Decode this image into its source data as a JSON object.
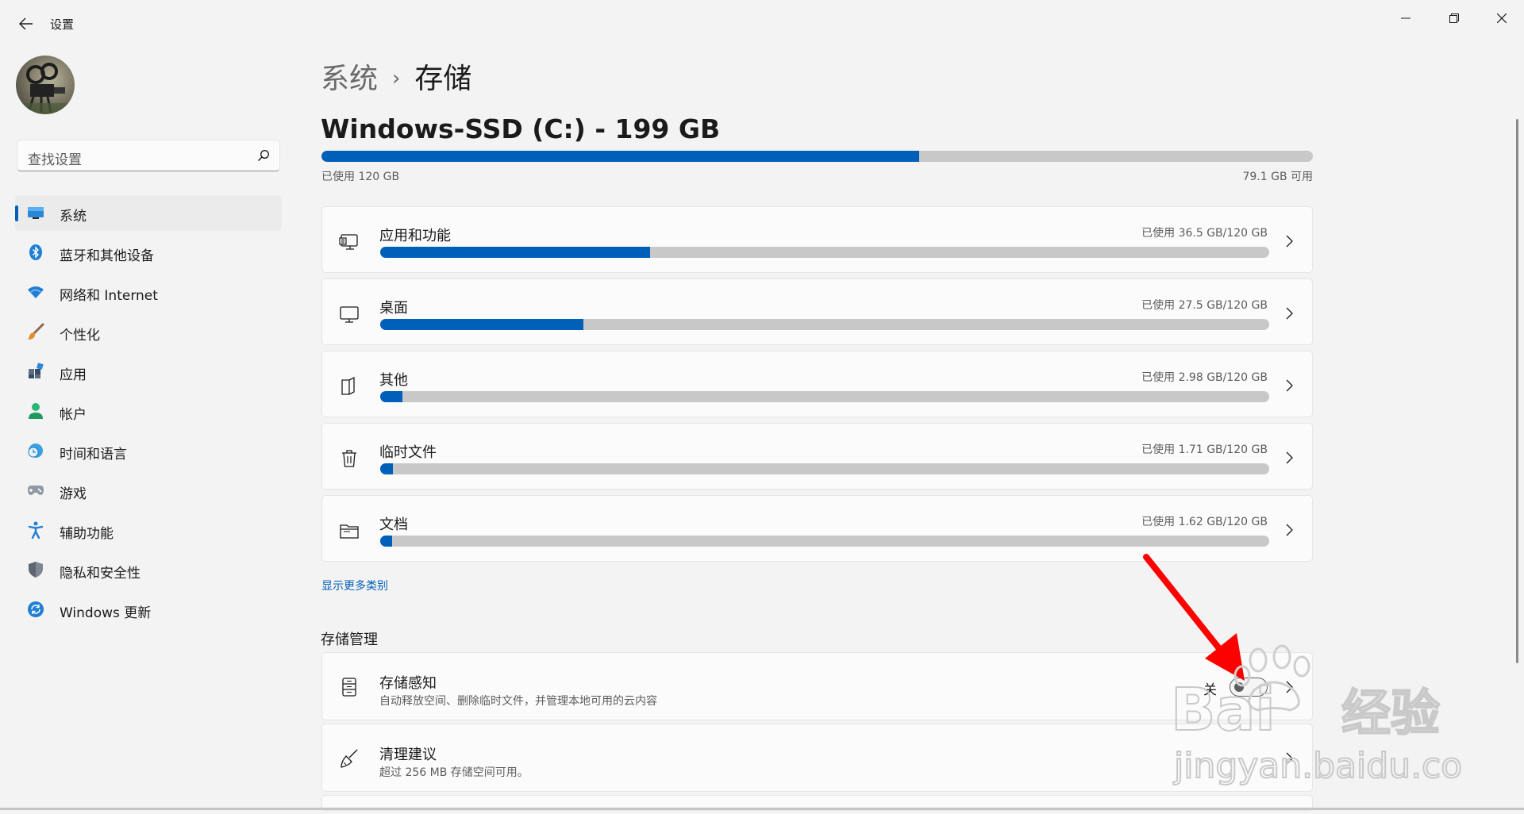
{
  "window": {
    "app_title": "设置"
  },
  "search": {
    "placeholder": "查找设置"
  },
  "sidebar": {
    "items": [
      {
        "label": "系统",
        "icon": "monitor-icon",
        "active": true
      },
      {
        "label": "蓝牙和其他设备",
        "icon": "bluetooth-icon",
        "active": false
      },
      {
        "label": "网络和 Internet",
        "icon": "wifi-icon",
        "active": false
      },
      {
        "label": "个性化",
        "icon": "brush-icon",
        "active": false
      },
      {
        "label": "应用",
        "icon": "apps-icon",
        "active": false
      },
      {
        "label": "帐户",
        "icon": "person-icon",
        "active": false
      },
      {
        "label": "时间和语言",
        "icon": "clock-globe-icon",
        "active": false
      },
      {
        "label": "游戏",
        "icon": "gamepad-icon",
        "active": false
      },
      {
        "label": "辅助功能",
        "icon": "accessibility-icon",
        "active": false
      },
      {
        "label": "隐私和安全性",
        "icon": "shield-icon",
        "active": false
      },
      {
        "label": "Windows 更新",
        "icon": "update-icon",
        "active": false
      }
    ]
  },
  "breadcrumb": {
    "parent": "系统",
    "separator": "›",
    "current": "存储"
  },
  "drive": {
    "title": "Windows-SSD (C:) - 199 GB",
    "used_text": "已使用 120 GB",
    "free_text": "79.1 GB 可用",
    "used_fraction": 0.603
  },
  "categories": [
    {
      "label": "应用和功能",
      "usage": "已使用 36.5 GB/120 GB",
      "fraction": 0.304,
      "icon": "apps-features-icon"
    },
    {
      "label": "桌面",
      "usage": "已使用 27.5 GB/120 GB",
      "fraction": 0.229,
      "icon": "desktop-icon"
    },
    {
      "label": "其他",
      "usage": "已使用 2.98 GB/120 GB",
      "fraction": 0.025,
      "icon": "other-files-icon"
    },
    {
      "label": "临时文件",
      "usage": "已使用 1.71 GB/120 GB",
      "fraction": 0.014,
      "icon": "trash-icon"
    },
    {
      "label": "文档",
      "usage": "已使用 1.62 GB/120 GB",
      "fraction": 0.013,
      "icon": "folder-icon"
    }
  ],
  "more_link": "显示更多类别",
  "management": {
    "title": "存储管理",
    "storage_sense": {
      "title": "存储感知",
      "subtitle": "自动释放空间、删除临时文件，并管理本地可用的云内容",
      "toggle_label": "关",
      "toggle_on": false
    },
    "cleanup": {
      "title": "清理建议",
      "subtitle": "超过 256 MB 存储空间可用。"
    }
  },
  "watermark": {
    "brand": "Baidu经验",
    "url": "jingyan.baidu.com"
  },
  "colors": {
    "accent": "#005fb8",
    "bar_track": "#c8c8c8",
    "annotation_arrow": "#ff0000"
  }
}
